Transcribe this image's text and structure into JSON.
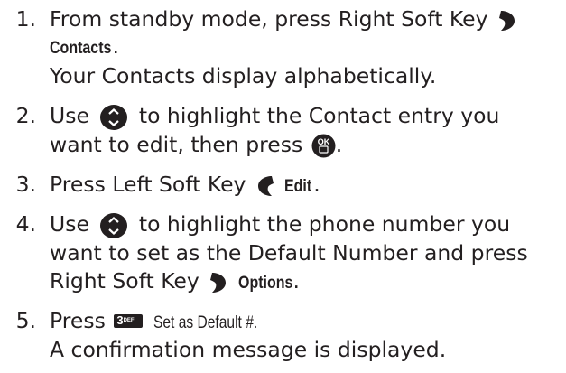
{
  "steps": [
    {
      "num": "1.",
      "l1_pre": "From standby mode, press Right Soft Key",
      "l2_bold": "Contacts",
      "l2_post": ".",
      "l3": "Your Contacts display alphabetically."
    },
    {
      "num": "2.",
      "l1_pre": "Use",
      "l1_post": "to highlight the Contact entry you",
      "l2_pre": "want to edit, then press",
      "l2_post": "."
    },
    {
      "num": "3.",
      "l1_pre": "Press Left Soft Key",
      "l1_bold": "Edit",
      "l1_post": "."
    },
    {
      "num": "4.",
      "l1_pre": "Use",
      "l1_post": "to highlight the phone number you",
      "l2": "want to set as the Default Number and press",
      "l3_pre": "Right Soft Key",
      "l3_bold": "Options",
      "l3_post": "."
    },
    {
      "num": "5.",
      "l1_pre": "Press",
      "key_digit": "3",
      "key_letters": "DEF",
      "l1_label": "Set as Default #.",
      "l2": "A confirmation message is displayed."
    }
  ],
  "icons": {
    "right_soft_key": "right-soft-key-icon",
    "left_soft_key": "left-soft-key-icon",
    "nav_key": "navigation-key-icon",
    "ok_key": "ok-key-icon",
    "ok_label": "OK"
  }
}
